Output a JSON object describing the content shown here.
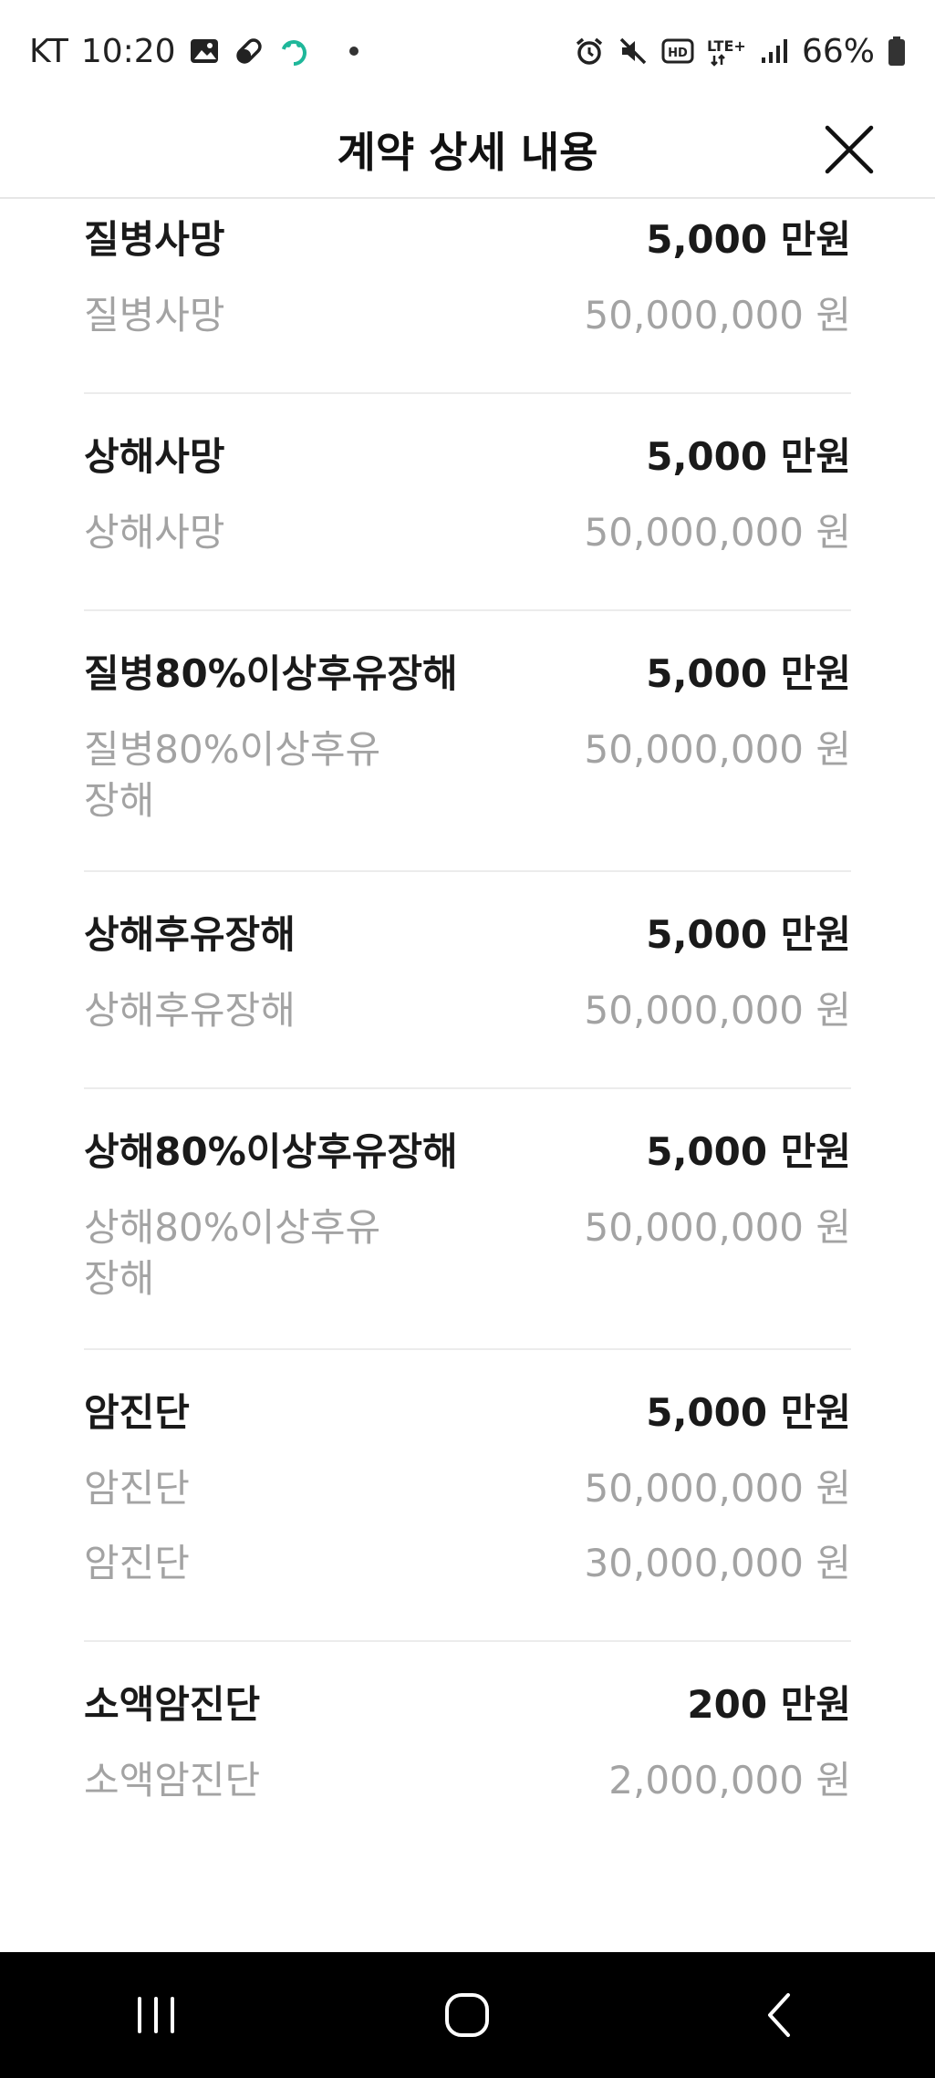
{
  "status_bar": {
    "carrier": "KT",
    "time": "10:20",
    "network": "LTE+",
    "battery": "66%"
  },
  "header": {
    "title": "계약 상세 내용"
  },
  "coverages": [
    {
      "title": "질병사망",
      "amount": "5,000 만원",
      "details": [
        {
          "label": "질병사망",
          "value": "50,000,000 원"
        }
      ]
    },
    {
      "title": "상해사망",
      "amount": "5,000 만원",
      "details": [
        {
          "label": "상해사망",
          "value": "50,000,000 원"
        }
      ]
    },
    {
      "title": "질병80%이상후유장해",
      "amount": "5,000 만원",
      "details": [
        {
          "label": "질병80%이상후유장해",
          "value": "50,000,000 원"
        }
      ]
    },
    {
      "title": "상해후유장해",
      "amount": "5,000 만원",
      "details": [
        {
          "label": "상해후유장해",
          "value": "50,000,000 원"
        }
      ]
    },
    {
      "title": "상해80%이상후유장해",
      "amount": "5,000 만원",
      "details": [
        {
          "label": "상해80%이상후유장해",
          "value": "50,000,000 원"
        }
      ]
    },
    {
      "title": "암진단",
      "amount": "5,000 만원",
      "details": [
        {
          "label": "암진단",
          "value": "50,000,000 원"
        },
        {
          "label": "암진단",
          "value": "30,000,000 원"
        }
      ]
    },
    {
      "title": "소액암진단",
      "amount": "200 만원",
      "details": [
        {
          "label": "소액암진단",
          "value": "2,000,000 원"
        }
      ]
    }
  ]
}
